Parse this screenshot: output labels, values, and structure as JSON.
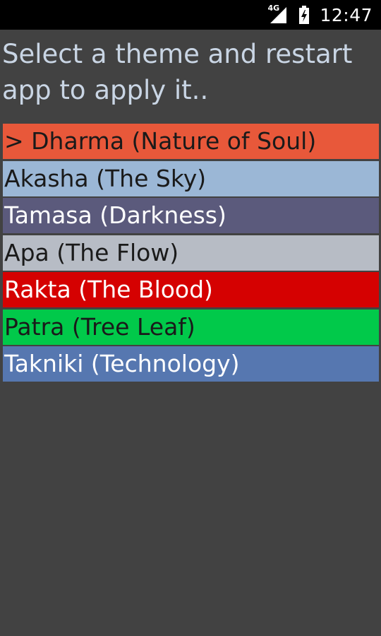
{
  "status_bar": {
    "network_label": "4G",
    "time": "12:47",
    "icons": [
      "signal-icon",
      "battery-charging-icon"
    ]
  },
  "prompt": {
    "text": "Select a theme and restart app to apply it.."
  },
  "themes": [
    {
      "label": "> Dharma (Nature of Soul)",
      "bg": "#e8583a",
      "fg": "#1a1a1a"
    },
    {
      "label": "Akasha (The Sky)",
      "bg": "#9bb7d6",
      "fg": "#1a1a1a"
    },
    {
      "label": "Tamasa (Darkness)",
      "bg": "#5b5a7c",
      "fg": "#ffffff"
    },
    {
      "label": "Apa (The Flow)",
      "bg": "#b7bcc5",
      "fg": "#1a1a1a"
    },
    {
      "label": "Rakta (The Blood)",
      "bg": "#d50101",
      "fg": "#ffffff"
    },
    {
      "label": "Patra (Tree Leaf)",
      "bg": "#01c94a",
      "fg": "#1a1a1a"
    },
    {
      "label": "Takniki (Technology)",
      "bg": "#5677b0",
      "fg": "#ffffff"
    }
  ]
}
